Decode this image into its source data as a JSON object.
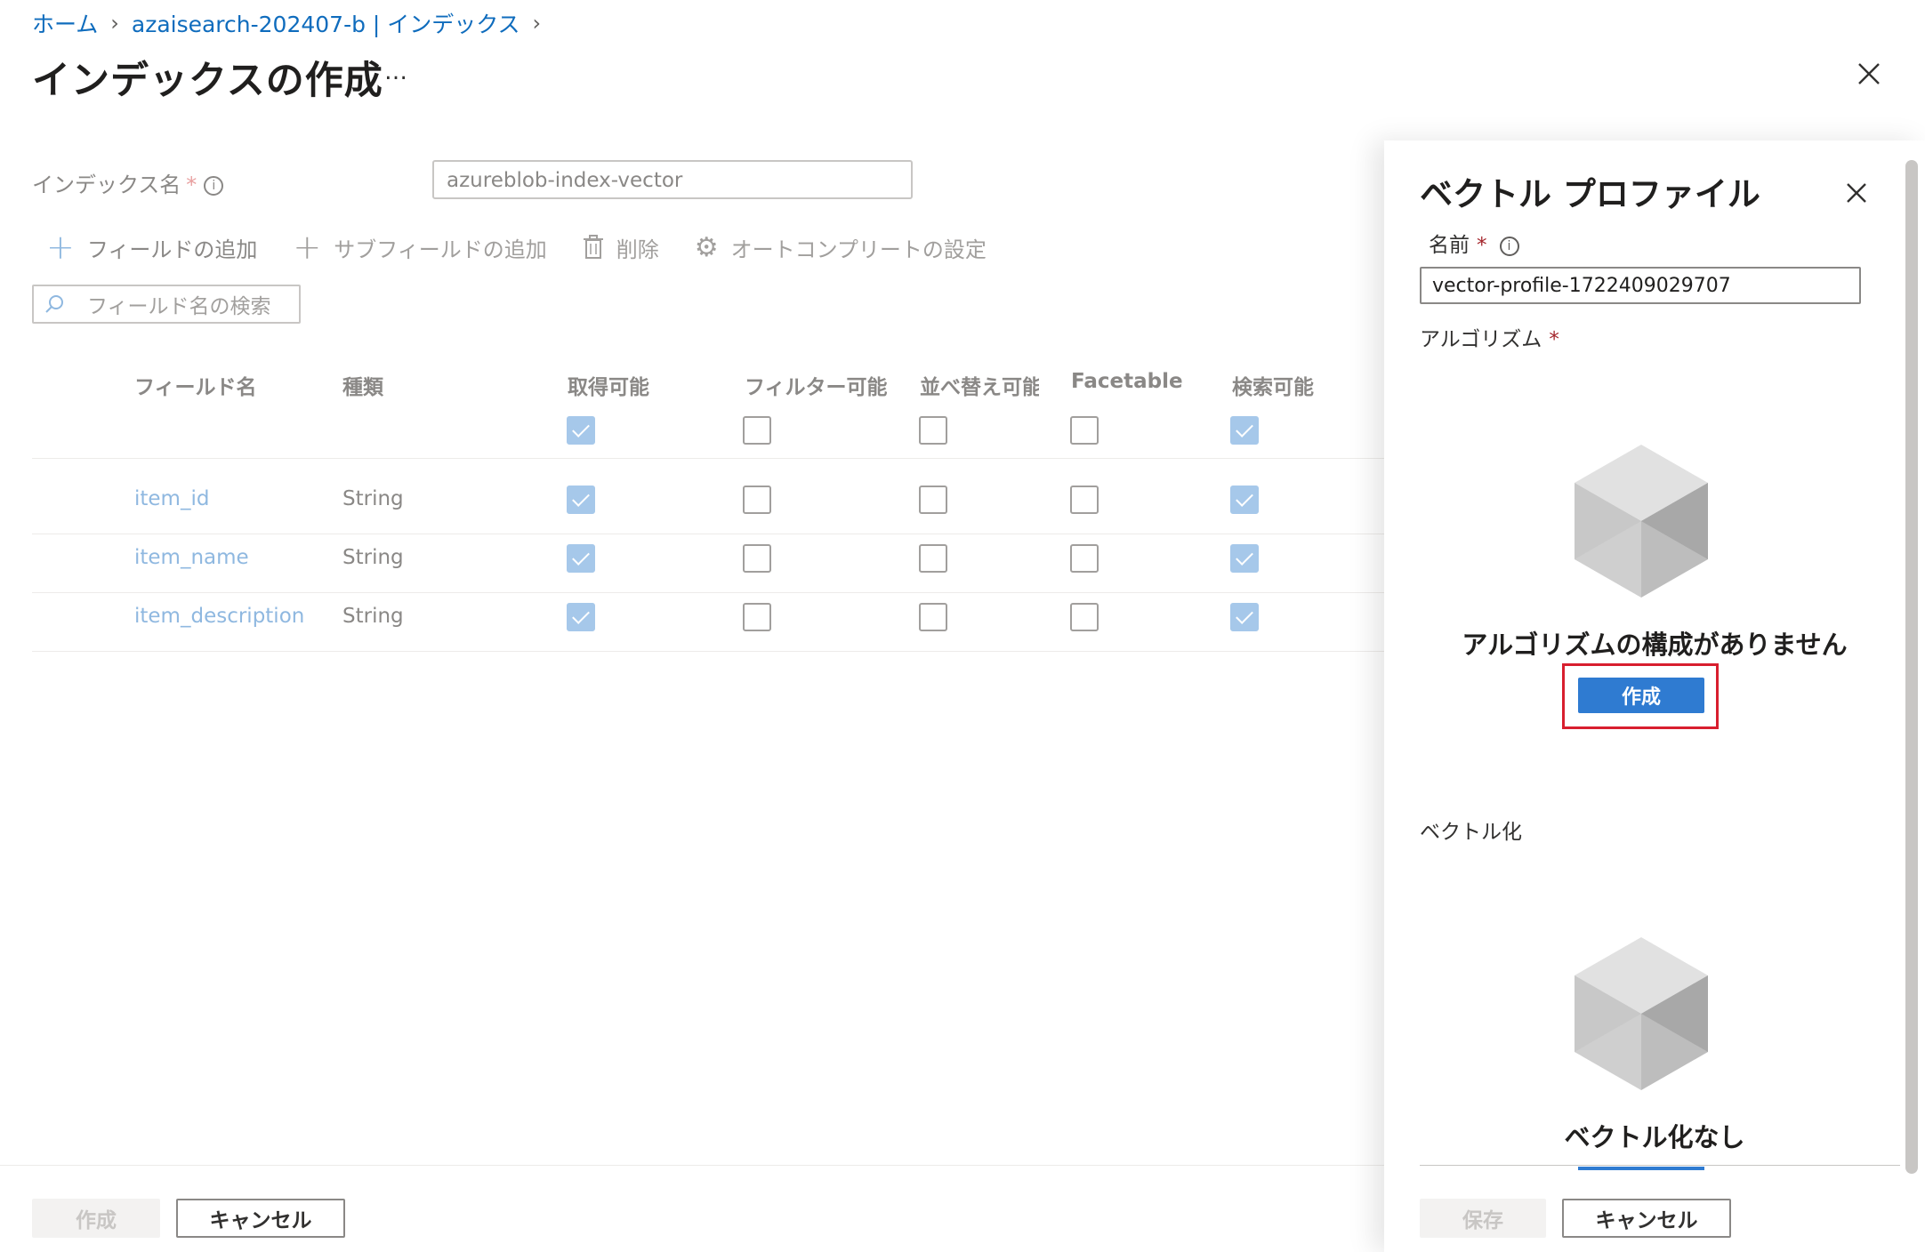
{
  "breadcrumb": {
    "home": "ホーム",
    "resource": "azaisearch-202407-b | インデックス"
  },
  "page": {
    "title": "インデックスの作成",
    "more": "…"
  },
  "index_name": {
    "label": "インデックス名",
    "required": "*",
    "value": "azureblob-index-vector"
  },
  "toolbar": {
    "add_field": "フィールドの追加",
    "add_subfield": "サブフィールドの追加",
    "delete": "削除",
    "autocomplete": "オートコンプリートの設定"
  },
  "search": {
    "placeholder": "フィールド名の検索"
  },
  "table": {
    "headers": [
      "フィールド名",
      "種類",
      "取得可能",
      "フィルター可能",
      "並べ替え可能",
      "Facetable",
      "検索可能"
    ],
    "header_checks": [
      true,
      false,
      false,
      false,
      true
    ],
    "rows": [
      {
        "name": "item_id",
        "type": "String",
        "checks": [
          true,
          false,
          false,
          false,
          true
        ]
      },
      {
        "name": "item_name",
        "type": "String",
        "checks": [
          true,
          false,
          false,
          false,
          true
        ]
      },
      {
        "name": "item_description",
        "type": "String",
        "checks": [
          true,
          false,
          false,
          false,
          true
        ]
      }
    ]
  },
  "footer": {
    "create": "作成",
    "cancel": "キャンセル"
  },
  "panel": {
    "title": "ベクトル プロファイル",
    "name_label": "名前",
    "name_required": "*",
    "name_value": "vector-profile-1722409029707",
    "algorithm_label": "アルゴリズム",
    "algorithm_required": "*",
    "algorithm_empty": "アルゴリズムの構成がありません",
    "create_button": "作成",
    "vectorizer_label": "ベクトル化",
    "vectorizer_empty": "ベクトル化なし",
    "save": "保存",
    "cancel": "キャンセル"
  }
}
